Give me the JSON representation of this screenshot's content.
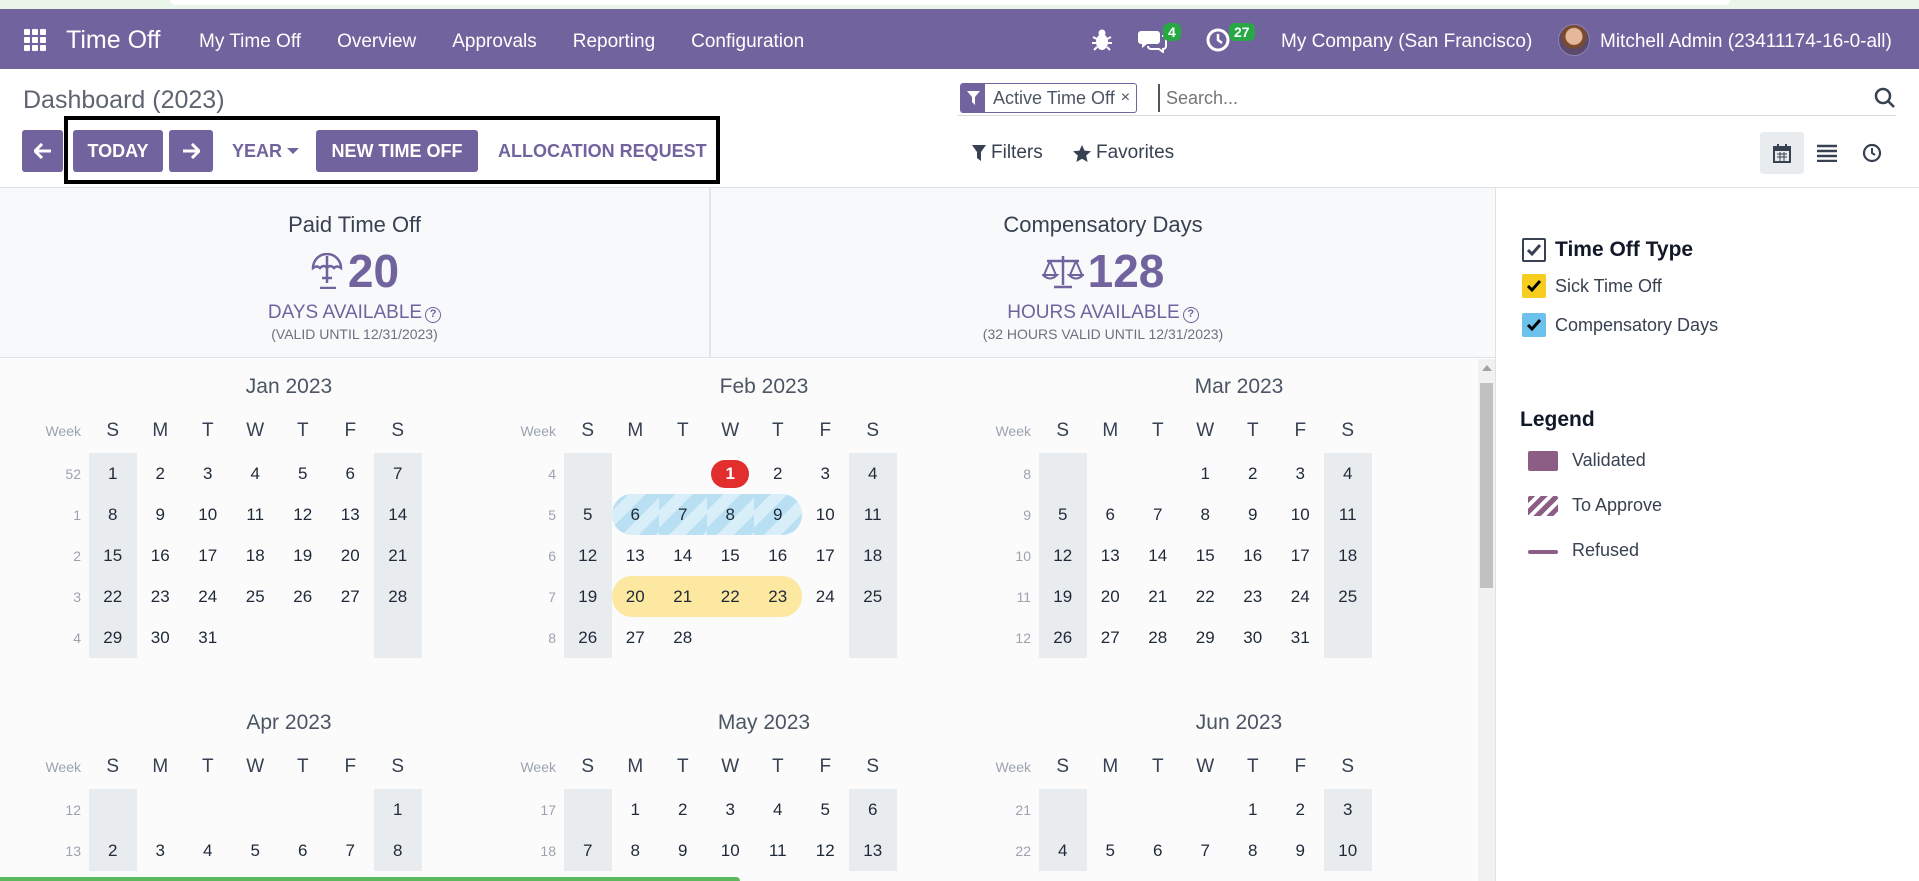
{
  "navbar": {
    "app_name": "Time Off",
    "menu": [
      "My Time Off",
      "Overview",
      "Approvals",
      "Reporting",
      "Configuration"
    ],
    "messages_count": "4",
    "activities_count": "27",
    "company": "My Company (San Francisco)",
    "user": "Mitchell Admin (23411174-16-0-all)"
  },
  "control": {
    "title": "Dashboard (2023)",
    "today_label": "TODAY",
    "year_label": "YEAR",
    "new_label": "NEW TIME OFF",
    "allocation_label": "ALLOCATION REQUEST",
    "facet_label": "Active Time Off",
    "facet_close": "×",
    "search_placeholder": "Search...",
    "filters_label": "Filters",
    "favorites_label": "Favorites"
  },
  "stats": [
    {
      "name": "Paid Time Off",
      "value": "20",
      "unit": "DAYS AVAILABLE",
      "valid": "(VALID UNTIL 12/31/2023)",
      "icon": "umbrella-icon"
    },
    {
      "name": "Compensatory Days",
      "value": "128",
      "unit": "HOURS AVAILABLE",
      "valid": "(32 HOURS VALID UNTIL 12/31/2023)",
      "icon": "scale-icon"
    }
  ],
  "calendar": {
    "week_label": "Week",
    "weekdays": [
      "S",
      "M",
      "T",
      "W",
      "T",
      "F",
      "S"
    ],
    "months": [
      {
        "title": "Jan 2023",
        "weeks": [
          [
            52,
            "1",
            "2",
            "3",
            "4",
            "5",
            "6",
            "7"
          ],
          [
            1,
            "8",
            "9",
            "10",
            "11",
            "12",
            "13",
            "14"
          ],
          [
            2,
            "15",
            "16",
            "17",
            "18",
            "19",
            "20",
            "21"
          ],
          [
            3,
            "22",
            "23",
            "24",
            "25",
            "26",
            "27",
            "28"
          ],
          [
            4,
            "29",
            "30",
            "31",
            "",
            "",
            "",
            ""
          ]
        ]
      },
      {
        "title": "Feb 2023",
        "weeks": [
          [
            4,
            "",
            "",
            "",
            "1",
            "2",
            "3",
            "4"
          ],
          [
            5,
            "5",
            "6",
            "7",
            "8",
            "9",
            "10",
            "11"
          ],
          [
            6,
            "12",
            "13",
            "14",
            "15",
            "16",
            "17",
            "18"
          ],
          [
            7,
            "19",
            "20",
            "21",
            "22",
            "23",
            "24",
            "25"
          ],
          [
            8,
            "26",
            "27",
            "28",
            "",
            "",
            "",
            ""
          ]
        ]
      },
      {
        "title": "Mar 2023",
        "weeks": [
          [
            8,
            "",
            "",
            "",
            "1",
            "2",
            "3",
            "4"
          ],
          [
            9,
            "5",
            "6",
            "7",
            "8",
            "9",
            "10",
            "11"
          ],
          [
            10,
            "12",
            "13",
            "14",
            "15",
            "16",
            "17",
            "18"
          ],
          [
            11,
            "19",
            "20",
            "21",
            "22",
            "23",
            "24",
            "25"
          ],
          [
            12,
            "26",
            "27",
            "28",
            "29",
            "30",
            "31",
            ""
          ]
        ]
      },
      {
        "title": "Apr 2023",
        "weeks": [
          [
            12,
            "",
            "",
            "",
            "",
            "",
            "",
            "1"
          ],
          [
            13,
            "2",
            "3",
            "4",
            "5",
            "6",
            "7",
            "8"
          ]
        ]
      },
      {
        "title": "May 2023",
        "weeks": [
          [
            17,
            "",
            "1",
            "2",
            "3",
            "4",
            "5",
            "6"
          ],
          [
            18,
            "7",
            "8",
            "9",
            "10",
            "11",
            "12",
            "13"
          ]
        ]
      },
      {
        "title": "Jun 2023",
        "weeks": [
          [
            21,
            "",
            "",
            "",
            "",
            "1",
            "2",
            "3"
          ],
          [
            22,
            "4",
            "5",
            "6",
            "7",
            "8",
            "9",
            "10"
          ]
        ]
      }
    ],
    "today": {
      "month": "Feb 2023",
      "day": "1"
    },
    "compensatory_days": {
      "month": "Feb 2023",
      "days": [
        "6",
        "7",
        "8",
        "9"
      ]
    },
    "sick_days": {
      "month": "Feb 2023",
      "days": [
        "20",
        "21",
        "22",
        "23"
      ]
    }
  },
  "side_panel": {
    "heading": "Time Off Type",
    "types": [
      {
        "label": "Sick Time Off",
        "color": "#f7cd1f"
      },
      {
        "label": "Compensatory Days",
        "color": "#6cc1ed"
      }
    ],
    "legend_title": "Legend",
    "legend": [
      "Validated",
      "To Approve",
      "Refused"
    ]
  },
  "colors": {
    "brand": "#71639e",
    "today": "#e32e2e",
    "legend": "#8c5e86"
  }
}
